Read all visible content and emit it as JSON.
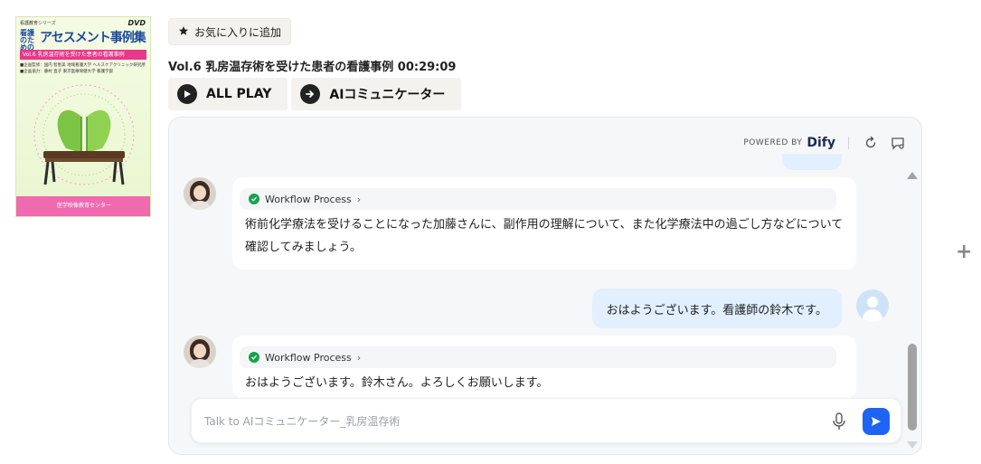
{
  "cover": {
    "series": "看護教育シリーズ",
    "dvd": "DVD",
    "small_title": "看護のための",
    "main_title": "アセスメント事例集",
    "vol_band": "Vol.6 乳房温存術を受けた患者の看護事例",
    "credit1": "■企画監修：国内 智恵美 地域看護大学 ヘルスケアクリニック研究所",
    "credit2": "■企画協力：藤村 直子 東京医療保健大学 看護学部",
    "publisher": "医学映像教育センター"
  },
  "favorite_button": {
    "label": "お気に入りに追加",
    "icon": "star-icon"
  },
  "video_title": "Vol.6 乳房温存術を受けた患者の看護事例 00:29:09",
  "buttons": {
    "all_play": "ALL PLAY",
    "ai_communicator": "AIコミュニケーター"
  },
  "chat": {
    "powered_by": "POWERED BY",
    "brand": "Dify",
    "messages": [
      {
        "role": "bot",
        "workflow_label": "Workflow Process",
        "text": "術前化学療法を受けることになった加藤さんに、副作用の理解について、また化学療法中の過ごし方などについて確認してみましょう。"
      },
      {
        "role": "user",
        "text": "おはようございます。看護師の鈴木です。"
      },
      {
        "role": "bot",
        "workflow_label": "Workflow Process",
        "text": "おはようございます。鈴木さん。よろしくお願いします。"
      }
    ],
    "input_placeholder": "Talk to AIコミュニケーター_乳房温存術"
  },
  "colors": {
    "accent": "#1d64f2",
    "user_bubble": "#e1effe",
    "check": "#16a34a"
  }
}
